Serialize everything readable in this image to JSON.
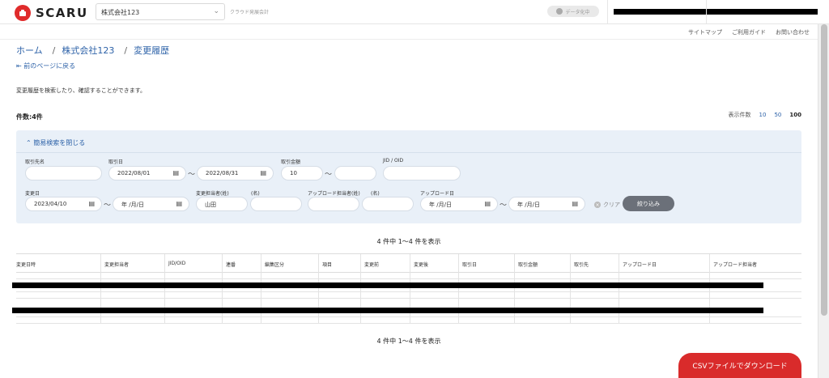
{
  "header": {
    "logo_text": "SCARU",
    "company_selected": "株式会社123",
    "subtitle": "クラウド発展会計",
    "data_pill": "データ化中",
    "brand_color": "#e02b2b"
  },
  "util_links": [
    "サイトマップ",
    "ご利用ガイド",
    "お問い合わせ"
  ],
  "breadcrumb": [
    "ホーム",
    "株式会社123",
    "変更履歴"
  ],
  "back_link": "前のページに戻る",
  "description": "変更履歴を検索したり、確認することができます。",
  "count_label": "件数:4件",
  "per_page": {
    "label": "表示件数",
    "options": [
      "10",
      "50",
      "100"
    ],
    "active": "100"
  },
  "search_panel": {
    "toggle": "簡易検索を閉じる",
    "fields": {
      "partner_label": "取引先名",
      "partner_value": "",
      "trade_date_label": "取引日",
      "trade_date_from": "2022/08/01",
      "trade_date_to": "2022/08/31",
      "amount_label": "取引金額",
      "amount_from": "10",
      "amount_to": "",
      "jid_label": "JID / OID",
      "jid_value": "",
      "change_date_label": "変更日",
      "change_date_from": "2023/04/10",
      "change_date_to": "年 /月/日",
      "changer_last_label": "変更担当者(姓)",
      "changer_first_label": "(名)",
      "changer_last_value": "山田",
      "changer_first_value": "",
      "uploader_last_label": "アップロード担当者(姓)",
      "uploader_first_label": "(名)",
      "upload_date_label": "アップロード日",
      "upload_date_from": "年 /月/日",
      "upload_date_to": "年 /月/日"
    },
    "tilde": "〜",
    "clear": "クリア",
    "filter_button": "絞り込み"
  },
  "result_info": "4 件中 1〜4 件を表示",
  "table": {
    "headers": [
      "変更日時",
      "変更担当者",
      "JID/OID",
      "連番",
      "編集区分",
      "項目",
      "変更前",
      "変更後",
      "取引日",
      "取引金額",
      "取引先",
      "アップロード日",
      "アップロード担当者"
    ]
  },
  "csv_button": "CSVファイルでダウンロード"
}
